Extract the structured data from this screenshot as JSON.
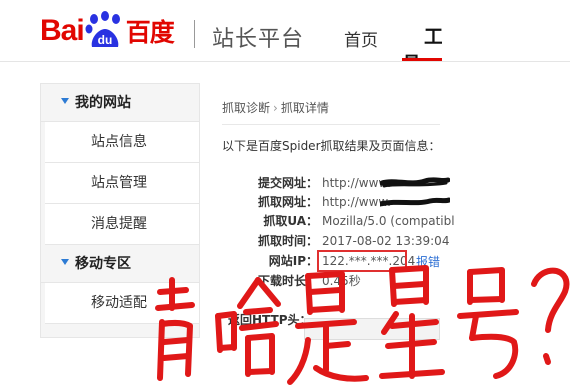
{
  "header": {
    "logo": {
      "bai": "Bai",
      "du": "du",
      "cn": "百度"
    },
    "site_title": "站长平台",
    "nav": {
      "home": "首页",
      "tools": "工具"
    },
    "accent_color": "#e10601"
  },
  "sidebar": {
    "groups": [
      {
        "label": "我的网站",
        "items": [
          "站点信息",
          "站点管理",
          "消息提醒"
        ]
      },
      {
        "label": "移动专区",
        "items": [
          "移动适配"
        ]
      }
    ]
  },
  "main": {
    "breadcrumb": [
      "抓取诊断",
      "抓取详情"
    ],
    "intro": "以下是百度Spider抓取结果及页面信息：",
    "fields": [
      {
        "label": "提交网址：",
        "value": "http://www."
      },
      {
        "label": "抓取网址：",
        "value": "http://www."
      },
      {
        "label": "抓取UA：",
        "value": "Mozilla/5.0 (compatibl"
      },
      {
        "label": "抓取时间：",
        "value": "2017-08-02 13:39:04"
      },
      {
        "label": "网站IP：",
        "value": "122.***.***.204"
      },
      {
        "label": "下载时长：",
        "value": "0.45秒"
      }
    ],
    "report_link": "报错",
    "headers_label": "返回HTTP头："
  },
  "annotation": {
    "text": "肯啥是星号？",
    "color": "#e01818"
  }
}
